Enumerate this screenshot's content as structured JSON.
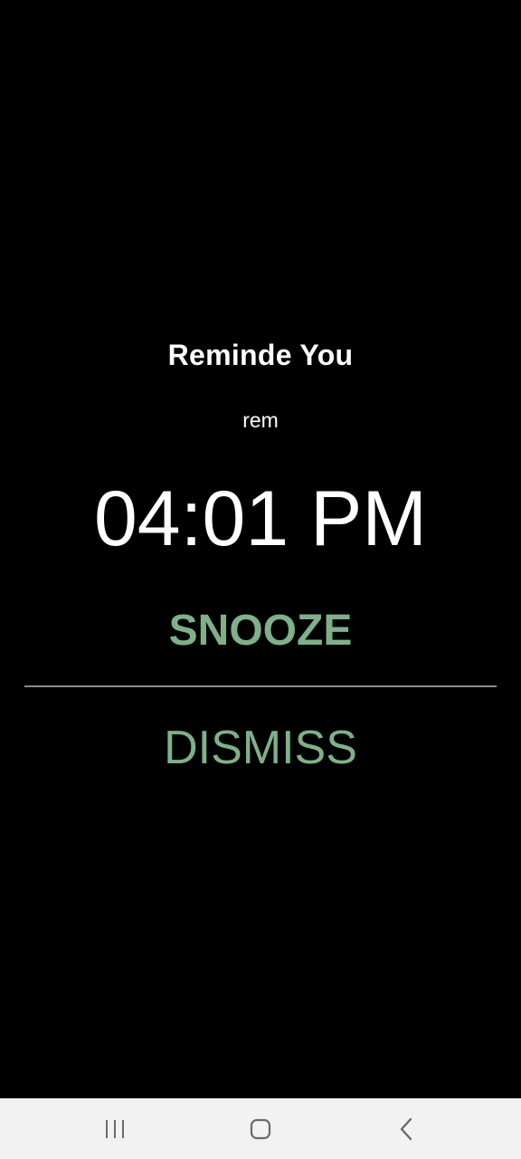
{
  "alarm": {
    "title": "Reminde You",
    "label": "rem",
    "time": "04:01 PM",
    "snooze_label": "SNOOZE",
    "dismiss_label": "DISMISS"
  },
  "colors": {
    "background": "#000000",
    "text": "#ffffff",
    "accent": "#7fb08a",
    "divider": "#8a8a8a",
    "nav_background": "#f2f2f2",
    "nav_icon": "#6b6b6b"
  },
  "navbar": {
    "icons": [
      "recents-icon",
      "home-icon",
      "back-icon"
    ]
  }
}
